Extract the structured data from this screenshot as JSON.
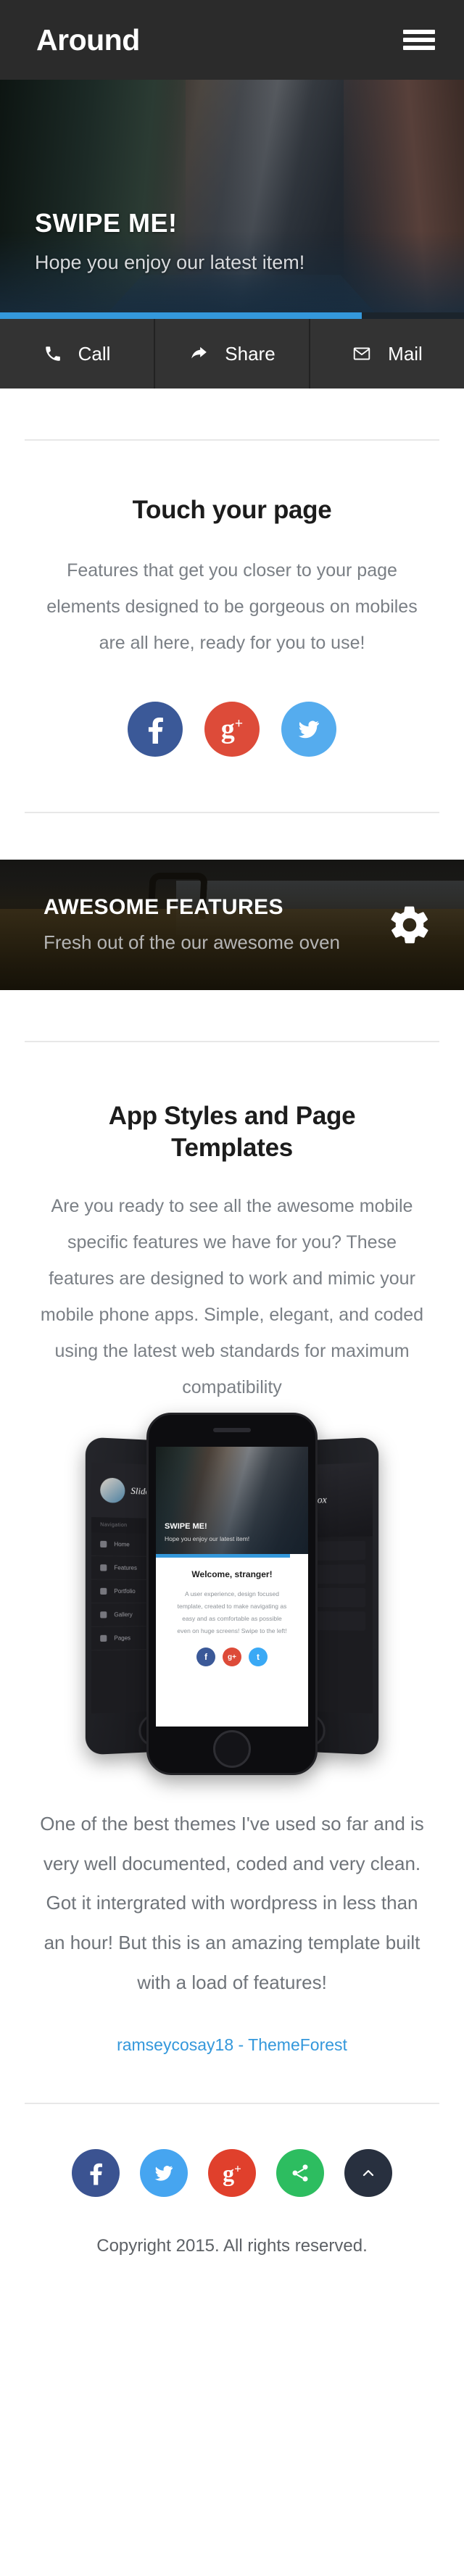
{
  "header": {
    "brand": "Around",
    "menu_icon": "hamburger-icon"
  },
  "hero": {
    "title": "SWIPE ME!",
    "subtitle": "Hope you enjoy our latest item!",
    "progress_percent": 78,
    "progress_color": "#3498db"
  },
  "actionbar": {
    "items": [
      {
        "icon": "phone-icon",
        "label": "Call"
      },
      {
        "icon": "share-arrow-icon",
        "label": "Share"
      },
      {
        "icon": "envelope-icon",
        "label": "Mail"
      }
    ]
  },
  "touch_section": {
    "title": "Touch your page",
    "body": "Features that get you closer to your page elements designed to be gorgeous on mobiles are all here, ready for you to use!",
    "socials": [
      {
        "name": "facebook",
        "icon": "facebook-icon",
        "color": "#3b5998"
      },
      {
        "name": "googleplus",
        "icon": "google-plus-icon",
        "color": "#dd4b39"
      },
      {
        "name": "twitter",
        "icon": "twitter-icon",
        "color": "#55acee"
      }
    ]
  },
  "parallax": {
    "title": "AWESOME FEATURES",
    "subtitle": "Fresh out of the our awesome oven",
    "icon": "gear-icon"
  },
  "app_section": {
    "title": "App Styles and Page Templates",
    "body": "Are you ready to see all the awesome mobile specific features we have for you? These features are designed to work and mimic your mobile phone apps. Simple, elegant, and coded using the latest web standards for maximum compatibility"
  },
  "mockup": {
    "left_phone": {
      "logo": "Slidebox",
      "nav_label": "Navigation",
      "nav_items": [
        "Home",
        "Features",
        "Portfolio",
        "Gallery",
        "Pages"
      ]
    },
    "right_phone": {
      "logo": "Slidebox"
    },
    "center_phone": {
      "hero_title": "SWIPE ME!",
      "hero_subtitle": "Hope you enjoy our latest item!",
      "welcome_title": "Welcome, stranger!",
      "welcome_lines": [
        "A user experience, design focused",
        "template, created to make navigating as",
        "easy and as comfortable as possible",
        "even on huge screens! Swipe to the left!"
      ],
      "socials": [
        {
          "name": "facebook",
          "glyph": "f",
          "color": "#3b5998"
        },
        {
          "name": "googleplus",
          "glyph": "g+",
          "color": "#dd4b39"
        },
        {
          "name": "twitter",
          "glyph": "t",
          "color": "#3aa9f5"
        }
      ]
    }
  },
  "testimonial": {
    "quote": "One of the best themes I've used so far and is very well documented, coded and very clean. Got it intergrated with wordpress in less than an hour! But this is an amazing template built with a load of features!",
    "author": "ramseycosay18 - ThemeForest",
    "author_color": "#3498db"
  },
  "footer": {
    "socials": [
      {
        "name": "facebook",
        "icon": "facebook-icon",
        "color": "#3b5391"
      },
      {
        "name": "twitter",
        "icon": "twitter-icon",
        "color": "#46a5f0"
      },
      {
        "name": "googleplus",
        "icon": "google-plus-icon",
        "color": "#e0402c"
      },
      {
        "name": "share",
        "icon": "share-nodes-icon",
        "color": "#2dbd60"
      },
      {
        "name": "scroll-top",
        "icon": "chevron-up-icon",
        "color": "#28303f"
      }
    ],
    "copyright": "Copyright 2015. All rights reserved."
  }
}
